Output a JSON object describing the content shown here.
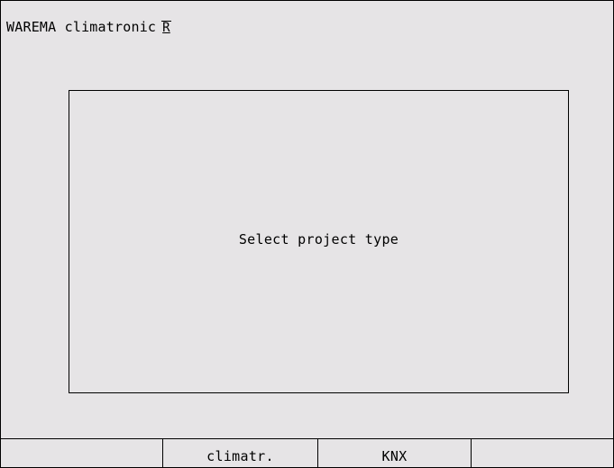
{
  "header": {
    "app_title": "WAREMA climatronic",
    "registered_mark": "R"
  },
  "dialog": {
    "message": "Select project type"
  },
  "softkeys": [
    {
      "label": ""
    },
    {
      "label": "climatr."
    },
    {
      "label": "KNX"
    },
    {
      "label": ""
    }
  ],
  "colors": {
    "background": "#e6e4e6",
    "border": "#000000",
    "text": "#000000"
  }
}
